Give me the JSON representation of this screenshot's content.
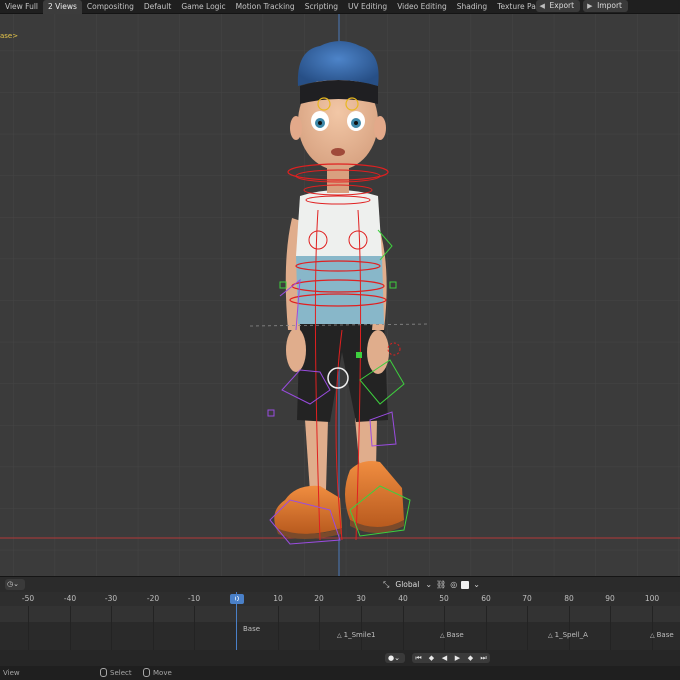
{
  "workspace_tabs": [
    "View Full",
    "2 Views",
    "Compositing",
    "Default",
    "Game Logic",
    "Motion Tracking",
    "Scripting",
    "UV Editing",
    "Video Editing",
    "Shading",
    "Texture Paint"
  ],
  "active_tab": "2 Views",
  "add_tab_label": "+",
  "export_label": "Export",
  "import_label": "Import",
  "viewport_label": "ase>",
  "transform_orientation": "Global",
  "ruler_numbers": [
    "-50",
    "-40",
    "-30",
    "-20",
    "-10",
    "0",
    "10",
    "20",
    "30",
    "40",
    "50",
    "60",
    "70",
    "80",
    "90",
    "100"
  ],
  "current_frame": "0",
  "markers": [
    {
      "label": "Base",
      "frame": 0
    },
    {
      "label": "1_Smile1",
      "frame": 25
    },
    {
      "label": "Base",
      "frame": 50
    },
    {
      "label": "1_Spell_A",
      "frame": 76
    },
    {
      "label": "Base",
      "frame": 101
    }
  ],
  "status": {
    "view_label": "View",
    "select_label": "Select",
    "move_label": "Move"
  },
  "colors": {
    "accent_blue": "#4a80c8",
    "viewport_bg": "#3b3b3b",
    "rig_red": "#e02020",
    "rig_green": "#3ecf3e",
    "rig_purple": "#9a4ce0"
  }
}
